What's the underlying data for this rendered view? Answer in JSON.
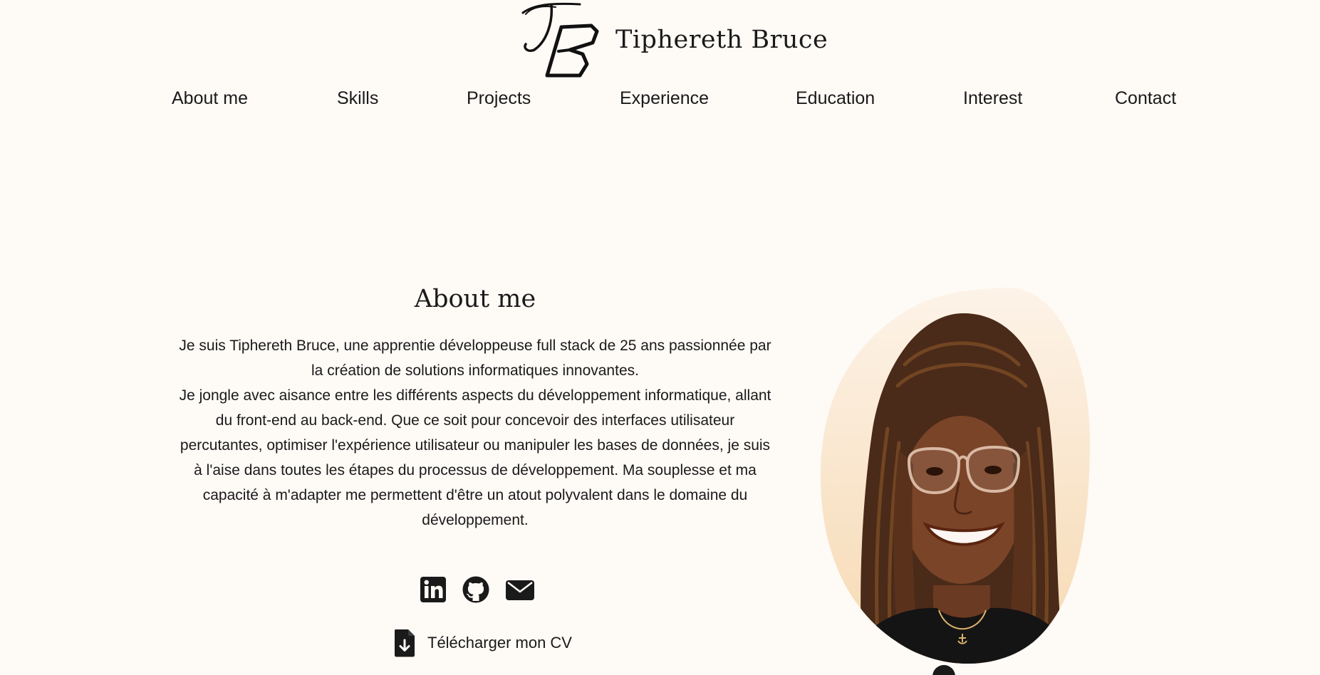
{
  "brand": {
    "name": "Tiphereth Bruce",
    "logo_icon": "tb-monogram-logo"
  },
  "nav": {
    "items": [
      {
        "label": "About me"
      },
      {
        "label": "Skills"
      },
      {
        "label": "Projects"
      },
      {
        "label": "Experience"
      },
      {
        "label": "Education"
      },
      {
        "label": "Interest"
      },
      {
        "label": "Contact"
      }
    ]
  },
  "about": {
    "title": "About me",
    "paragraph_1": "Je suis Tiphereth Bruce, une apprentie développeuse full stack de 25 ans passionnée par la création de solutions informatiques innovantes.",
    "paragraph_2": "Je jongle avec aisance entre les différents aspects du développement informatique, allant du front-end au back-end. Que ce soit pour concevoir des interfaces utilisateur percutantes, optimiser l'expérience utilisateur ou manipuler les bases de données, je suis à l'aise dans toutes les étapes du processus de développement. Ma souplesse et ma capacité à m'adapter me permettent d'être un atout polyvalent dans le domaine du développement."
  },
  "socials": [
    {
      "icon": "linkedin-icon"
    },
    {
      "icon": "github-icon"
    },
    {
      "icon": "email-icon"
    }
  ],
  "cv": {
    "label": "Télécharger mon CV",
    "icon": "file-download-icon"
  },
  "colors": {
    "background": "#fefaf6",
    "text": "#1a1a1a",
    "blob_light": "#fdf1e4",
    "blob_warm": "#f6dcb8"
  }
}
